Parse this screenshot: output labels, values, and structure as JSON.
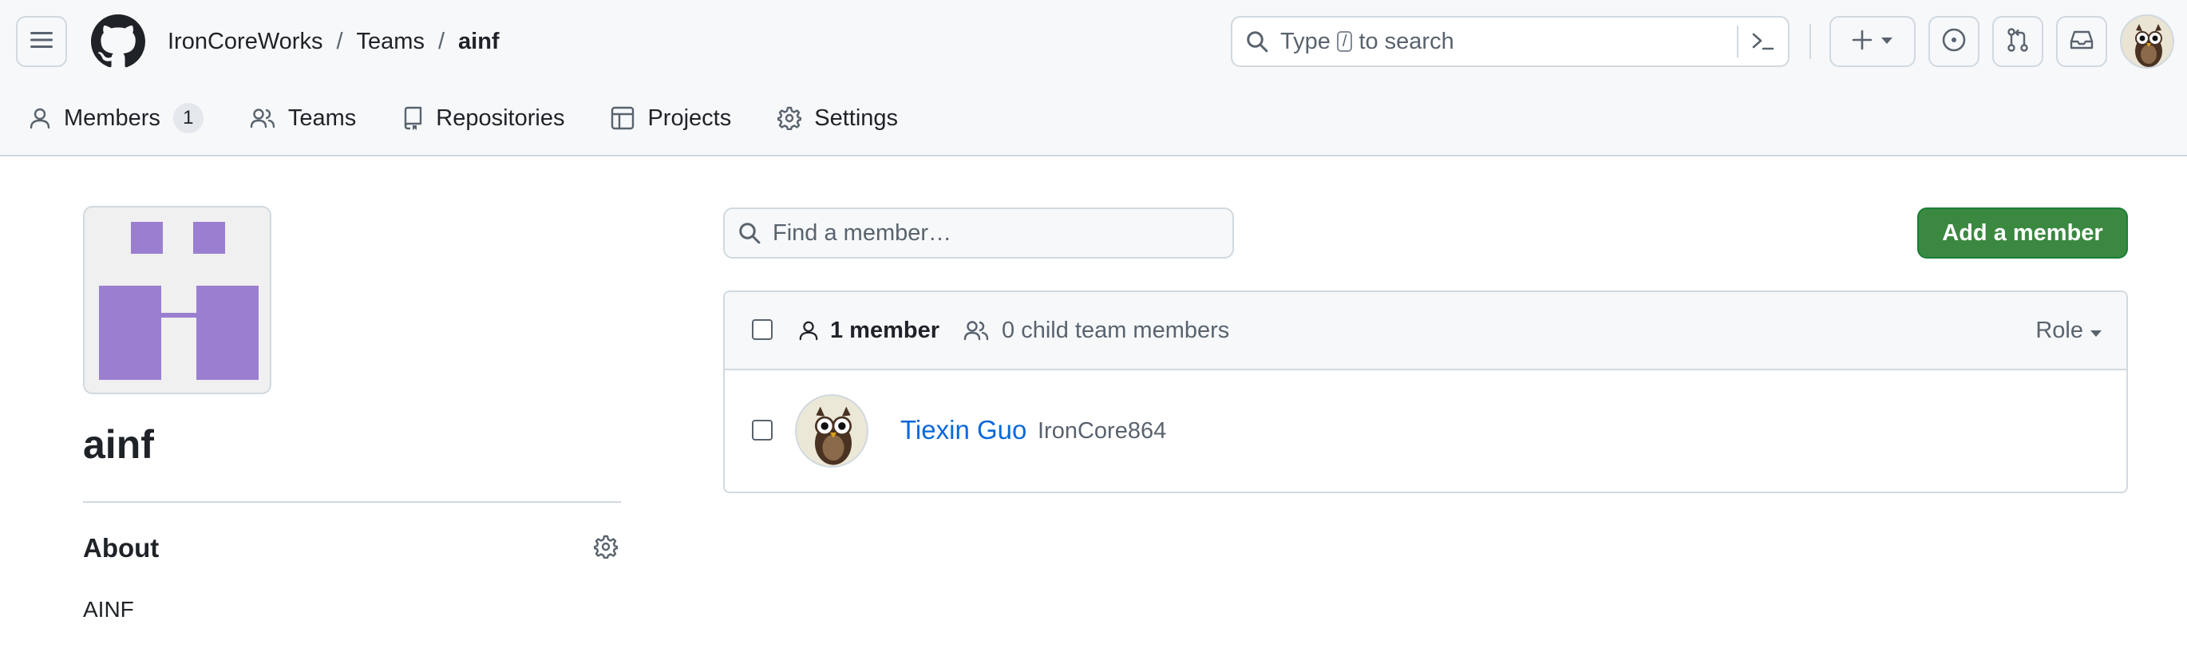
{
  "header": {
    "breadcrumb": {
      "org": "IronCoreWorks",
      "section": "Teams",
      "current": "ainf",
      "separator": "/"
    },
    "search": {
      "prefix": "Type",
      "key": "/",
      "suffix": "to search"
    },
    "icons": [
      "hamburger-icon",
      "github-logo",
      "search-icon",
      "command-palette-icon",
      "plus-icon",
      "caret-down-icon",
      "issue-icon",
      "pull-request-icon",
      "inbox-icon"
    ]
  },
  "tabs": [
    {
      "label": "Members",
      "count": "1",
      "icon": "person-icon"
    },
    {
      "label": "Teams",
      "icon": "people-icon"
    },
    {
      "label": "Repositories",
      "icon": "repo-icon"
    },
    {
      "label": "Projects",
      "icon": "table-icon"
    },
    {
      "label": "Settings",
      "icon": "gear-icon"
    }
  ],
  "team": {
    "name": "ainf",
    "about_heading": "About",
    "description": "AINF",
    "avatar_color": "#9a7fd1"
  },
  "members": {
    "find_placeholder": "Find a member…",
    "add_button": "Add a member",
    "summary": {
      "count_label": "1 member",
      "child_label": "0 child team members"
    },
    "role_filter": "Role",
    "rows": [
      {
        "name": "Tiexin Guo",
        "login": "IronCore864"
      }
    ]
  },
  "colors": {
    "primary_button": "#3b8841",
    "link": "#0969da",
    "header_bg": "#f6f8fa"
  }
}
